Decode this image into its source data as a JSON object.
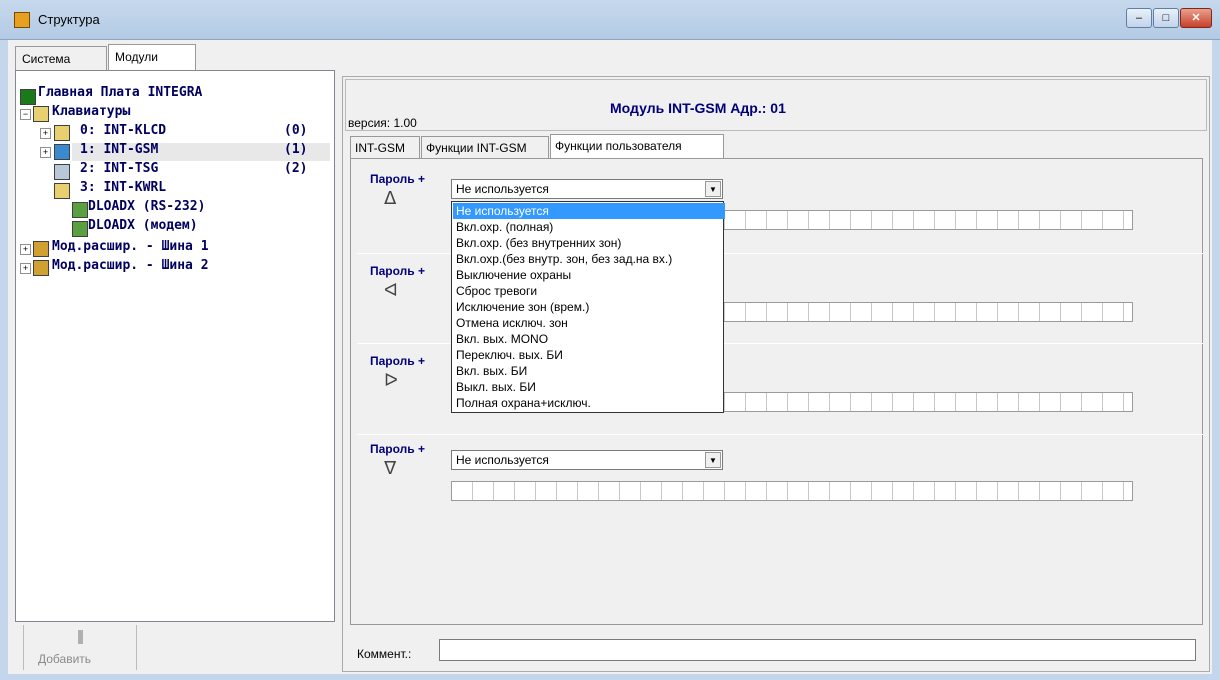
{
  "window": {
    "title": "Структура"
  },
  "tabs": [
    "Система",
    "Модули"
  ],
  "tree": {
    "root": "Главная Плата INTEGRA",
    "group": "Клавиатуры",
    "items": [
      {
        "label": "0: INT-KLCD",
        "num": "(0)"
      },
      {
        "label": "1: INT-GSM",
        "num": "(1)"
      },
      {
        "label": "2: INT-TSG",
        "num": "(2)"
      },
      {
        "label": "3: INT-KWRL",
        "num": ""
      },
      {
        "label": "DLOADX (RS-232)",
        "num": ""
      },
      {
        "label": "DLOADX (модем)",
        "num": ""
      }
    ],
    "ext1": "Мод.расшир. - Шина 1",
    "ext2": "Мод.расшир. - Шина 2"
  },
  "add_button": "Добавить",
  "module": {
    "title": "Модуль INT-GSM Адр.: 01",
    "version": "версия: 1.00"
  },
  "subtabs": [
    "INT-GSM",
    "Функции INT-GSM",
    "Функции пользователя"
  ],
  "password_label": "Пароль +",
  "rows": [
    {
      "arrow": "ᐃ",
      "value": "Не используется"
    },
    {
      "arrow": "ᐊ",
      "value": ""
    },
    {
      "arrow": "ᐅ",
      "value": ""
    },
    {
      "arrow": "ᐁ",
      "value": "Не используется"
    }
  ],
  "dropdown_options": [
    "Не используется",
    "Вкл.охр. (полная)",
    "Вкл.охр. (без внутренних зон)",
    "Вкл.охр.(без внутр. зон, без зад.на вх.)",
    "Выключение охраны",
    "Сброс тревоги",
    "Исключение зон (врем.)",
    "Отмена исключ. зон",
    "Вкл. вых. MONO",
    "Переключ. вых. БИ",
    "Вкл. вых. БИ",
    "Выкл. вых. БИ",
    "Полная охрана+исключ."
  ],
  "comment_label": "Коммент.:",
  "colors": {
    "accent": "#00007a",
    "selection": "#3399ff",
    "close": "#c8402a"
  }
}
